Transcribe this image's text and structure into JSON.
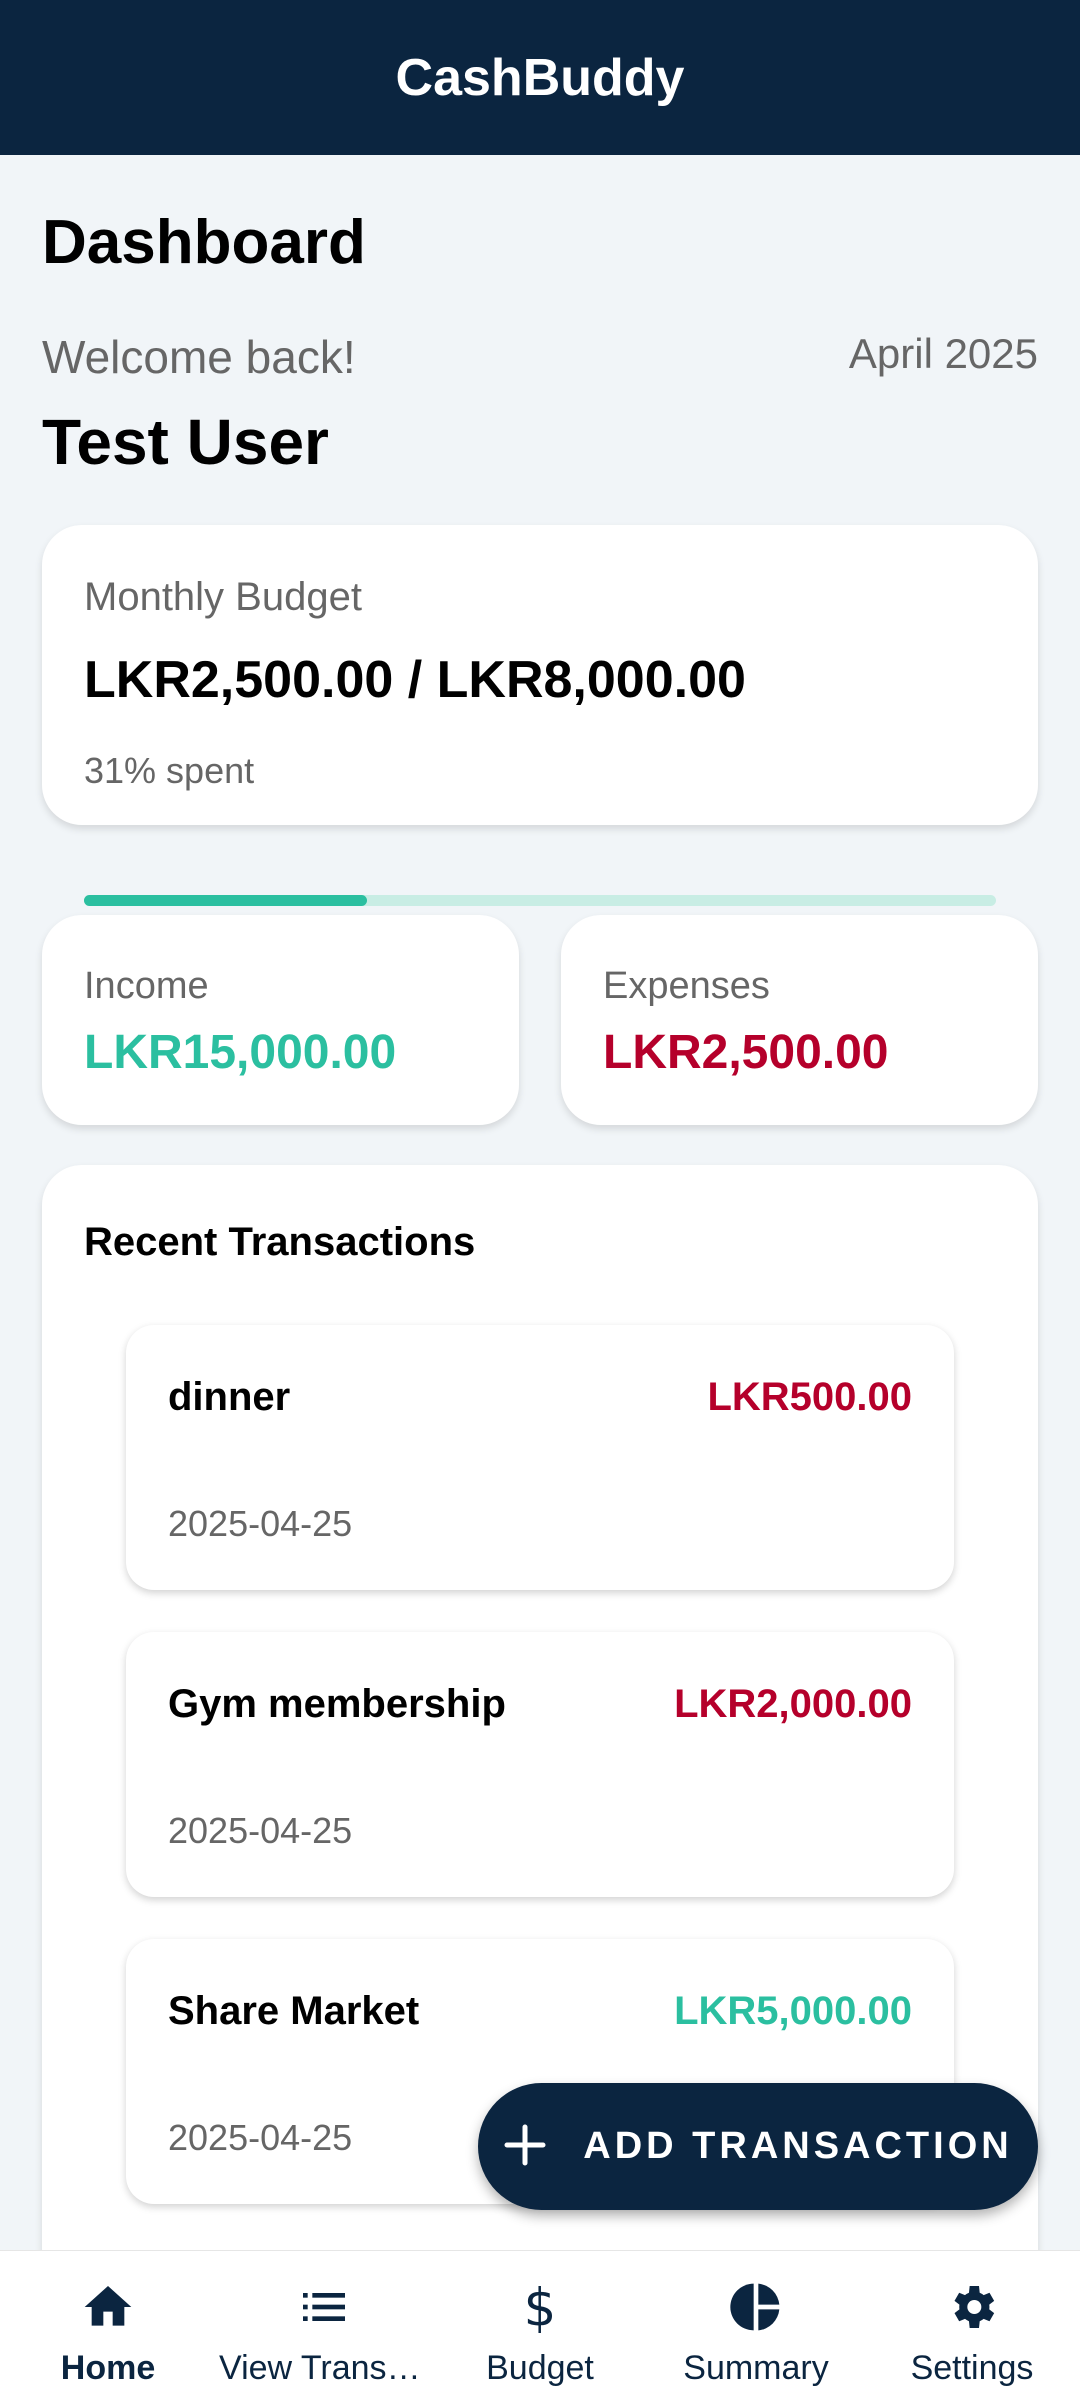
{
  "app": {
    "title": "CashBuddy"
  },
  "dashboard": {
    "title": "Dashboard",
    "welcome": "Welcome back!",
    "month": "April 2025",
    "username": "Test User"
  },
  "budget": {
    "label": "Monthly Budget",
    "amount": "LKR2,500.00 / LKR8,000.00",
    "spent_text": "31% spent",
    "progress_fraction": 0.31
  },
  "income": {
    "label": "Income",
    "value": "LKR15,000.00"
  },
  "expenses": {
    "label": "Expenses",
    "value": "LKR2,500.00"
  },
  "recent": {
    "title": "Recent Transactions",
    "items": [
      {
        "name": "dinner",
        "amount": "LKR500.00",
        "type": "expense",
        "date": "2025-04-25"
      },
      {
        "name": "Gym membership",
        "amount": "LKR2,000.00",
        "type": "expense",
        "date": "2025-04-25"
      },
      {
        "name": "Share Market",
        "amount": "LKR5,000.00",
        "type": "income",
        "date": "2025-04-25"
      }
    ]
  },
  "fab": {
    "icon": "plus-icon",
    "label": "ADD TRANSACTION"
  },
  "nav": {
    "items": [
      {
        "label": "Home",
        "icon": "home-icon",
        "active": true
      },
      {
        "label": "View Transa…",
        "icon": "list-icon",
        "active": false
      },
      {
        "label": "Budget",
        "icon": "dollar-icon",
        "active": false
      },
      {
        "label": "Summary",
        "icon": "pie-chart-icon",
        "active": false
      },
      {
        "label": "Settings",
        "icon": "gear-icon",
        "active": false
      }
    ]
  },
  "colors": {
    "primary": "#0b2540",
    "income": "#2bbfa0",
    "expense": "#b5002b",
    "background": "#f1f5f8"
  }
}
